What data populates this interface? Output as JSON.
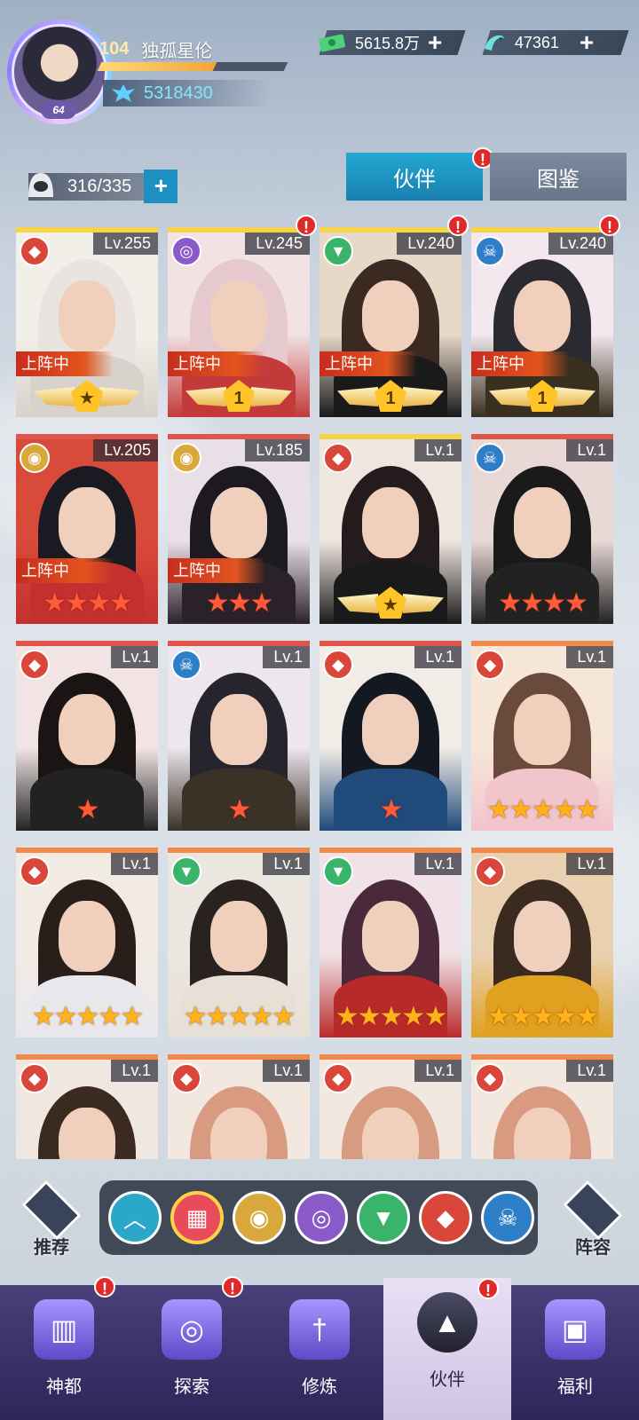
{
  "player": {
    "level": "104",
    "name": "独孤星伦",
    "avatar_badge": "64",
    "exp_fraction": 0.62,
    "power": "5318430"
  },
  "currencies": [
    {
      "icon": "cash-icon",
      "value": "5615.8万"
    },
    {
      "icon": "fish-icon",
      "value": "47361"
    }
  ],
  "roster": {
    "count": "316/335"
  },
  "tabs": [
    {
      "label": "伙伴",
      "active": true,
      "badge": "!"
    },
    {
      "label": "图鉴",
      "active": false
    }
  ],
  "cards": [
    {
      "level": "Lv.255",
      "faction": "fox",
      "on_team": "上阵中",
      "rank": "wing",
      "rank_text": "★",
      "top": "#f5d44a",
      "alert": false,
      "palette": [
        "#e9e4e0",
        "#d8d2cc",
        "#f2efe9"
      ]
    },
    {
      "level": "Lv.245",
      "faction": "purple",
      "on_team": "上阵中",
      "rank": "wing",
      "rank_text": "1",
      "top": "#f5d44a",
      "alert": true,
      "palette": [
        "#e5c9cf",
        "#c43a3a",
        "#f2e2e4"
      ]
    },
    {
      "level": "Lv.240",
      "faction": "green",
      "on_team": "上阵中",
      "rank": "wing",
      "rank_text": "1",
      "top": "#f5d44a",
      "alert": true,
      "palette": [
        "#3a2a22",
        "#1a1a1a",
        "#e8d8c8"
      ]
    },
    {
      "level": "Lv.240",
      "faction": "skull",
      "on_team": "上阵中",
      "rank": "wing",
      "rank_text": "1",
      "top": "#f5d44a",
      "alert": true,
      "palette": [
        "#2a2a30",
        "#3a3020",
        "#f2e8ee"
      ]
    },
    {
      "level": "Lv.205",
      "faction": "eye",
      "on_team": "上阵中",
      "rank": "stars",
      "stars": 4,
      "top": "#e0554a",
      "alert": false,
      "palette": [
        "#1a1a22",
        "#c43030",
        "#d84a3a"
      ]
    },
    {
      "level": "Lv.185",
      "faction": "eye",
      "on_team": "上阵中",
      "rank": "stars",
      "stars": 3,
      "top": "#e0554a",
      "alert": false,
      "palette": [
        "#1c1a20",
        "#2a2228",
        "#e8e0e6"
      ]
    },
    {
      "level": "Lv.1",
      "faction": "fox",
      "on_team": "",
      "rank": "wing",
      "rank_text": "★",
      "top": "#f5d44a",
      "alert": false,
      "palette": [
        "#241c1c",
        "#1a1a1a",
        "#f0e6e0"
      ]
    },
    {
      "level": "Lv.1",
      "faction": "skull",
      "on_team": "",
      "rank": "stars",
      "stars": 4,
      "top": "#e0554a",
      "alert": false,
      "palette": [
        "#1a1a1a",
        "#222222",
        "#e8d8d6"
      ]
    },
    {
      "level": "Lv.1",
      "faction": "fox",
      "on_team": "",
      "rank": "stars",
      "stars": 1,
      "top": "#e0554a",
      "alert": false,
      "palette": [
        "#1a1414",
        "#222222",
        "#f2e4e4"
      ]
    },
    {
      "level": "Lv.1",
      "faction": "skull",
      "on_team": "",
      "rank": "stars",
      "stars": 1,
      "top": "#e0554a",
      "alert": false,
      "palette": [
        "#26242c",
        "#3a3226",
        "#ede6ee"
      ]
    },
    {
      "level": "Lv.1",
      "faction": "fox",
      "on_team": "",
      "rank": "stars",
      "stars": 1,
      "top": "#e0554a",
      "alert": false,
      "palette": [
        "#141820",
        "#1f4a7a",
        "#f2ece6"
      ]
    },
    {
      "level": "Lv.1",
      "faction": "fox",
      "on_team": "",
      "rank": "stars",
      "stars": 5,
      "top": "#f0894a",
      "alert": false,
      "palette": [
        "#6a4a3a",
        "#f2c4cc",
        "#f6e6d8"
      ]
    },
    {
      "level": "Lv.1",
      "faction": "fox",
      "on_team": "",
      "rank": "stars",
      "stars": 5,
      "top": "#f0894a",
      "alert": false,
      "palette": [
        "#2a1e1a",
        "#e8e8ec",
        "#f2ebe4"
      ]
    },
    {
      "level": "Lv.1",
      "faction": "green",
      "on_team": "",
      "rank": "stars",
      "stars": 5,
      "top": "#f0894a",
      "alert": false,
      "palette": [
        "#2a221e",
        "#e6e0d6",
        "#ece6e0"
      ]
    },
    {
      "level": "Lv.1",
      "faction": "green",
      "on_team": "",
      "rank": "stars",
      "stars": 5,
      "top": "#f0894a",
      "alert": false,
      "palette": [
        "#4a2a3a",
        "#b82a2a",
        "#f0e2e6"
      ]
    },
    {
      "level": "Lv.1",
      "faction": "fox",
      "on_team": "",
      "rank": "stars",
      "stars": 5,
      "top": "#f0894a",
      "alert": false,
      "palette": [
        "#3a2a20",
        "#e0a020",
        "#e8d0b0"
      ]
    },
    {
      "level": "Lv.1",
      "faction": "fox",
      "on_team": "",
      "rank": "none",
      "top": "#f0894a",
      "alert": false,
      "palette": [
        "#3a2a20",
        "#e0a020",
        "#f0e8e0"
      ]
    },
    {
      "level": "Lv.1",
      "faction": "fox",
      "on_team": "",
      "rank": "none",
      "top": "#f0894a",
      "alert": false,
      "palette": [
        "#d89a80",
        "#c03a2a",
        "#f2e8e0"
      ]
    },
    {
      "level": "Lv.1",
      "faction": "fox",
      "on_team": "",
      "rank": "none",
      "top": "#f0894a",
      "alert": false,
      "palette": [
        "#d89a80",
        "#c03a2a",
        "#f2e8e0"
      ]
    },
    {
      "level": "Lv.1",
      "faction": "fox",
      "on_team": "",
      "rank": "none",
      "top": "#f0894a",
      "alert": false,
      "palette": [
        "#d89a80",
        "#c03a2a",
        "#f2e8e0"
      ]
    }
  ],
  "filters": {
    "recommend_label": "推荐",
    "lineup_label": "阵容",
    "buttons": [
      {
        "icon": "chevron-up-icon",
        "kind": "up"
      },
      {
        "icon": "grid-icon",
        "kind": "all"
      },
      {
        "icon": "eye-faction-icon",
        "kind": "eye"
      },
      {
        "icon": "purple-faction-icon",
        "kind": "purple"
      },
      {
        "icon": "green-faction-icon",
        "kind": "green"
      },
      {
        "icon": "fox-faction-icon",
        "kind": "fox"
      },
      {
        "icon": "skull-faction-icon",
        "kind": "skull"
      }
    ]
  },
  "nav": [
    {
      "label": "神都",
      "icon": "city-icon",
      "alert": true,
      "active": false
    },
    {
      "label": "探索",
      "icon": "portal-icon",
      "alert": true,
      "active": false
    },
    {
      "label": "修炼",
      "icon": "sword-icon",
      "alert": false,
      "active": false
    },
    {
      "label": "伙伴",
      "icon": "hooded-figure-icon",
      "alert": true,
      "active": true
    },
    {
      "label": "福利",
      "icon": "chest-icon",
      "alert": false,
      "active": false
    }
  ],
  "glyphs": {
    "alert": "!",
    "plus": "+",
    "star": "★"
  }
}
